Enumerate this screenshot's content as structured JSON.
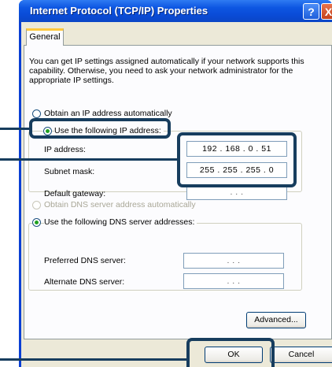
{
  "window": {
    "title": "Internet Protocol (TCP/IP) Properties",
    "help_glyph": "?",
    "close_glyph": "X"
  },
  "tabs": [
    {
      "label": "General"
    }
  ],
  "info_text": "You can get IP settings assigned automatically if your network supports this capability. Otherwise, you need to ask your network administrator for the appropriate IP settings.",
  "ip_section": {
    "auto_label": "Obtain an IP address automatically",
    "manual_label": "Use the following IP address:",
    "selected": "manual",
    "fields": [
      {
        "label": "IP address:",
        "value": "192 . 168 . 0 . 51"
      },
      {
        "label": "Subnet mask:",
        "value": "255 . 255 . 255 . 0"
      },
      {
        "label": "Default gateway:",
        "value": ". . ."
      }
    ]
  },
  "dns_section": {
    "auto_label": "Obtain DNS server address automatically",
    "manual_label": "Use the following DNS server addresses:",
    "selected": "manual",
    "fields": [
      {
        "label": "Preferred DNS server:",
        "value": ". . ."
      },
      {
        "label": "Alternate DNS server:",
        "value": ". . ."
      }
    ]
  },
  "buttons": {
    "advanced": "Advanced...",
    "ok": "OK",
    "cancel": "Cancel"
  },
  "colors": {
    "titlebar": "#0a4bd6",
    "highlight_box": "#173d5e",
    "dialog_bg": "#ece9d8",
    "radio_check": "#21a121"
  }
}
